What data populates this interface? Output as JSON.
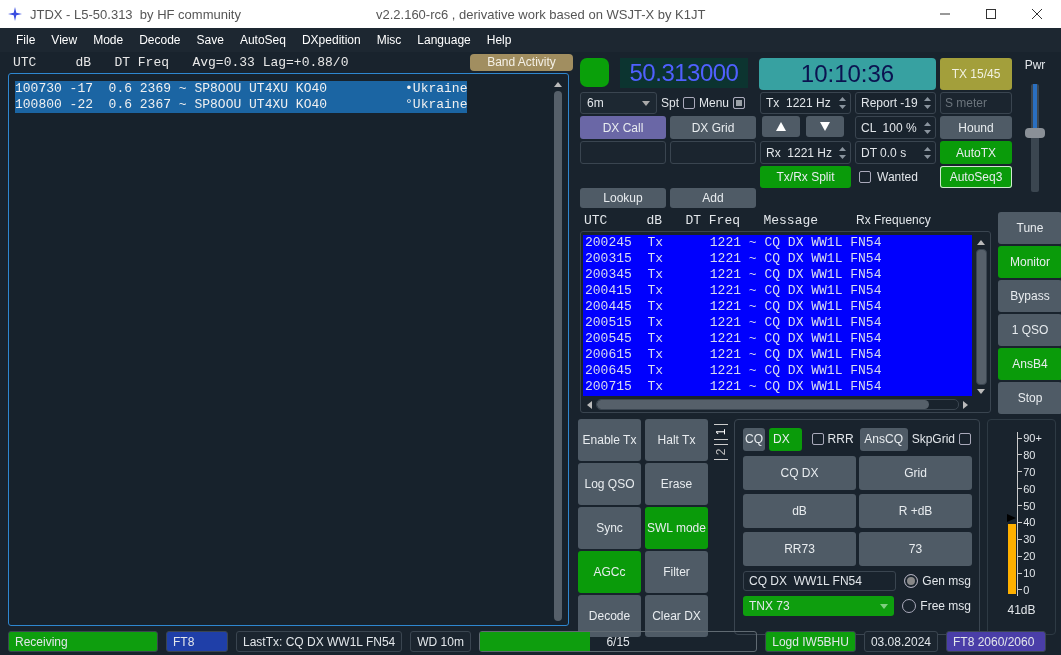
{
  "window": {
    "title": "JTDX - L5-50.313  by HF community",
    "subtitle": "v2.2.160-rc6 , derivative work based on WSJT-X by K1JT"
  },
  "menu": [
    "File",
    "View",
    "Mode",
    "Decode",
    "Save",
    "AutoSeq",
    "DXpedition",
    "Misc",
    "Language",
    "Help"
  ],
  "band_activity": {
    "header": "UTC     dB   DT Freq   Avg=0.33 Lag=+0.88/0",
    "button": "Band Activity",
    "lines": [
      {
        "text": "100730 -17  0.6 2369 ~ SP8OOU UT4XU KO40          •Ukraine",
        "selected": true
      },
      {
        "text": "100800 -22  0.6 2367 ~ SP8OOU UT4XU KO40          °Ukraine",
        "selected": true
      }
    ]
  },
  "controls": {
    "status_led": {
      "on": true
    },
    "frequency": "50.313000",
    "clock": "10:10:36",
    "tx_period": "TX 15/45",
    "band": "6m",
    "spt": {
      "label": "Spt",
      "checked": false
    },
    "menu_toggle": {
      "label": "Menu",
      "checked": true
    },
    "tx_freq": "Tx  1221 Hz",
    "report": "Report -19",
    "s_meter": {
      "placeholder": "S meter"
    },
    "dx_call": "DX Call",
    "dx_grid": "DX Grid",
    "cl": "CL  100 %",
    "hound": {
      "label": "Hound",
      "on": false
    },
    "rx_freq": "Rx  1221 Hz",
    "dt": "DT 0.0 s",
    "auto_tx": {
      "label": "AutoTX",
      "on": true
    },
    "split": {
      "label": "Tx/Rx Split",
      "on": true
    },
    "wanted": {
      "label": "Wanted",
      "checked": false
    },
    "autoseq": {
      "label": "AutoSeq3",
      "on": true
    },
    "lookup": "Lookup",
    "add": "Add",
    "pwr": {
      "label": "Pwr",
      "level": 0.55
    }
  },
  "rx_frequency": {
    "header": "UTC     dB   DT Freq   Message",
    "title": "Rx Frequency",
    "rows": [
      "200245  Tx      1221 ~ CQ DX WW1L FN54",
      "200315  Tx      1221 ~ CQ DX WW1L FN54",
      "200345  Tx      1221 ~ CQ DX WW1L FN54",
      "200415  Tx      1221 ~ CQ DX WW1L FN54",
      "200445  Tx      1221 ~ CQ DX WW1L FN54",
      "200515  Tx      1221 ~ CQ DX WW1L FN54",
      "200545  Tx      1221 ~ CQ DX WW1L FN54",
      "200615  Tx      1221 ~ CQ DX WW1L FN54",
      "200645  Tx      1221 ~ CQ DX WW1L FN54",
      "200715  Tx      1221 ~ CQ DX WW1L FN54"
    ]
  },
  "side_buttons": [
    {
      "label": "Tune",
      "on": false
    },
    {
      "label": "Monitor",
      "on": true
    },
    {
      "label": "Bypass",
      "on": false
    },
    {
      "label": "1 QSO",
      "on": false
    },
    {
      "label": "AnsB4",
      "on": true
    },
    {
      "label": "Stop",
      "on": false
    }
  ],
  "action_buttons": [
    {
      "label": "Enable Tx",
      "on": false
    },
    {
      "label": "Halt Tx",
      "on": false
    },
    {
      "label": "Log QSO",
      "on": false
    },
    {
      "label": "Erase",
      "on": false
    },
    {
      "label": "Sync",
      "on": false
    },
    {
      "label": "SWL mode",
      "on": true
    },
    {
      "label": "AGCc",
      "on": true
    },
    {
      "label": "Filter",
      "on": false
    },
    {
      "label": "Decode",
      "on": false
    },
    {
      "label": "Clear DX",
      "on": false
    }
  ],
  "message_tabs": [
    {
      "label": "1",
      "selected": true
    },
    {
      "label": "2",
      "selected": false
    }
  ],
  "messages": {
    "cq": {
      "label": "CQ",
      "on": false
    },
    "dx": {
      "label": "DX",
      "on": true
    },
    "rrr": {
      "label": "RRR",
      "checked": false
    },
    "ans_cq": "AnsCQ",
    "skp_grid": {
      "label": "SkpGrid",
      "checked": false
    },
    "buttons": [
      "CQ DX",
      "Grid",
      "dB",
      "R +dB",
      "RR73",
      "73"
    ],
    "gen_text": "CQ DX  WW1L FN54",
    "free_text": "TNX 73",
    "modes": [
      {
        "label": "Gen msg",
        "selected": true
      },
      {
        "label": "Free msg",
        "selected": false
      }
    ]
  },
  "signal_meter": {
    "scale": [
      "90+",
      "80",
      "70",
      "60",
      "50",
      "40",
      "30",
      "20",
      "10",
      "0"
    ],
    "level": 0.46,
    "reading": "41dB"
  },
  "status_bar": [
    {
      "kind": "text",
      "text": "Receiving",
      "color": "#0e9e0e"
    },
    {
      "kind": "text",
      "text": "FT8",
      "color": "#1f3fa8"
    },
    {
      "kind": "text",
      "text": "LastTx: CQ DX  WW1L FN54",
      "color": "#1b252f"
    },
    {
      "kind": "text",
      "text": "WD 10m",
      "color": "#1b252f"
    },
    {
      "kind": "progress",
      "text": "6/15",
      "level": 0.4
    },
    {
      "kind": "text",
      "text": "Logd IW5BHU",
      "color": "#0e9e0e"
    },
    {
      "kind": "text",
      "text": "03.08.2024",
      "color": "#1b252f"
    },
    {
      "kind": "text",
      "text": "FT8  2060/2060",
      "color": "#4a3ea8"
    }
  ]
}
